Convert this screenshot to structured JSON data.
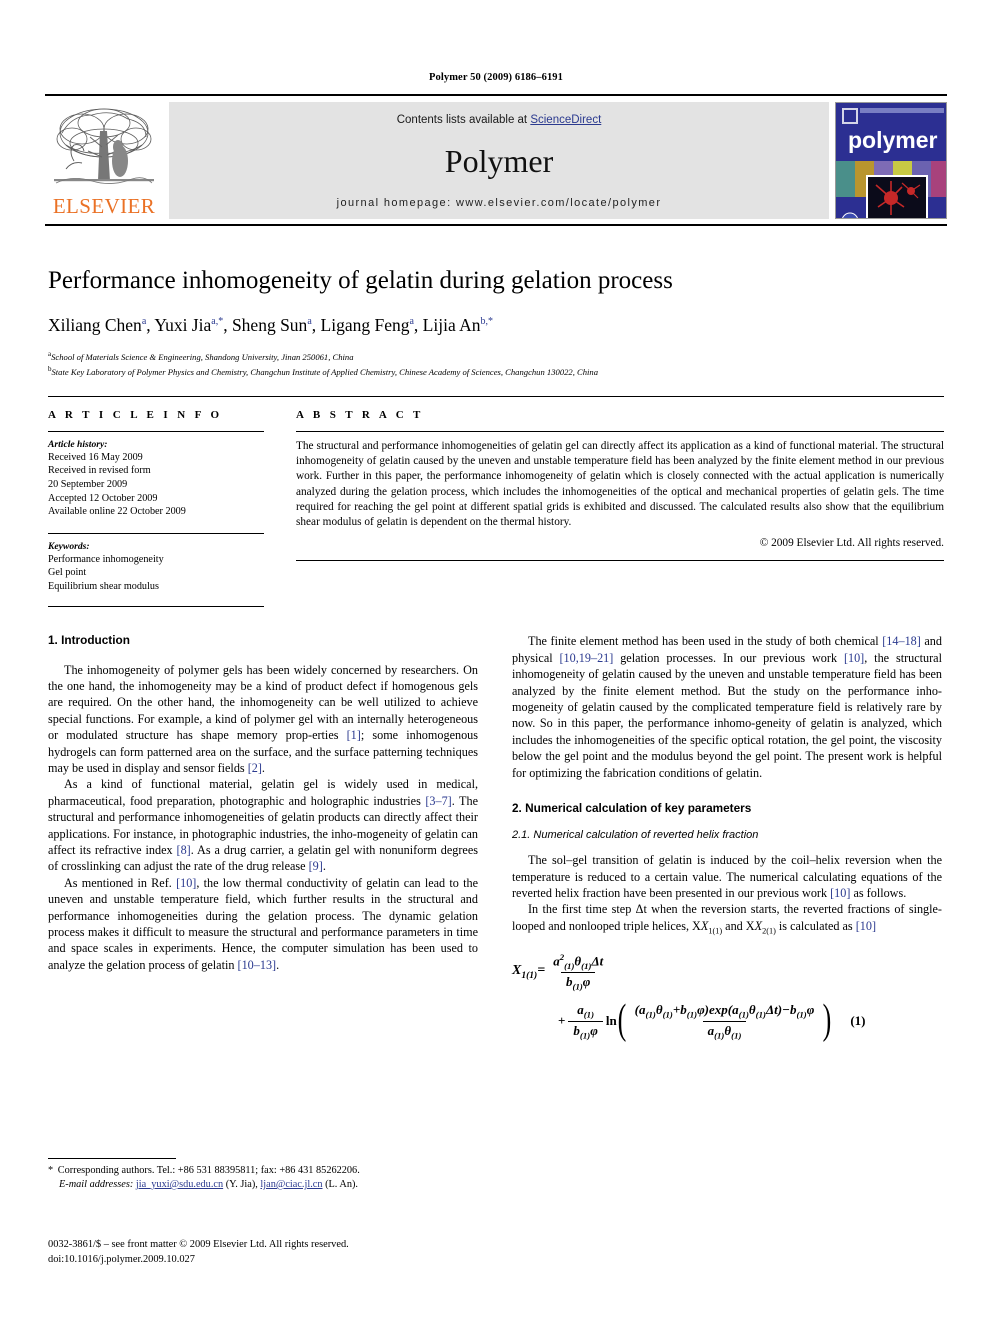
{
  "running_head": "Polymer 50 (2009) 6186–6191",
  "masthead": {
    "contents_prefix": "Contents lists available at ",
    "sciencedirect": "ScienceDirect",
    "journal_name": "Polymer",
    "homepage": "journal homepage: www.elsevier.com/locate/polymer",
    "publisher_wordmark": "ELSEVIER",
    "cover_wordmark": "polymer",
    "accent_orange": "#ea7125",
    "link_blue": "#2b3a8f",
    "cover_blue": "#2c2f92"
  },
  "article": {
    "title": "Performance inhomogeneity of gelatin during gelation process",
    "authors_html": "Xiliang Chen a, Yuxi Jia a,*, Sheng Sun a, Ligang Feng a, Lijia An b,*",
    "authors": [
      {
        "name": "Xiliang Chen",
        "marks": "a"
      },
      {
        "name": "Yuxi Jia",
        "marks": "a,*"
      },
      {
        "name": "Sheng Sun",
        "marks": "a"
      },
      {
        "name": "Ligang Feng",
        "marks": "a"
      },
      {
        "name": "Lijia An",
        "marks": "b,*"
      }
    ],
    "affiliations": [
      {
        "mark": "a",
        "text": "School of Materials Science & Engineering, Shandong University, Jinan 250061, China"
      },
      {
        "mark": "b",
        "text": "State Key Laboratory of Polymer Physics and Chemistry, Changchun Institute of Applied Chemistry, Chinese Academy of Sciences, Changchun 130022, China"
      }
    ]
  },
  "article_info": {
    "heading": "A R T I C L E   I N F O",
    "history_title": "Article history:",
    "history_lines": [
      "Received 16 May 2009",
      "Received in revised form",
      "20 September 2009",
      "Accepted 12 October 2009",
      "Available online 22 October 2009"
    ],
    "keywords_title": "Keywords:",
    "keywords": [
      "Performance inhomogeneity",
      "Gel point",
      "Equilibrium shear modulus"
    ]
  },
  "abstract": {
    "heading": "A B S T R A C T",
    "text": "The structural and performance inhomogeneities of gelatin gel can directly affect its application as a kind of functional material. The structural inhomogeneity of gelatin caused by the uneven and unstable temperature field has been analyzed by the finite element method in our previous work. Further in this paper, the performance inhomogeneity of gelatin which is closely connected with the actual application is numerically analyzed during the gelation process, which includes the inhomogeneities of the optical and mechanical properties of gelatin gels. The time required for reaching the gel point at different spatial grids is exhibited and discussed. The calculated results also show that the equilibrium shear modulus of gelatin is dependent on the thermal history.",
    "copyright": "© 2009 Elsevier Ltd. All rights reserved."
  },
  "sections": {
    "intro_heading": "1. Introduction",
    "intro_p1_a": "The inhomogeneity of polymer gels has been widely concerned by researchers. On the one hand, the inhomogeneity may be a kind of product defect if homogenous gels are required. On the other hand, the inhomogeneity can be well utilized to achieve special functions. For example, a kind of polymer gel with an internally heterogeneous or modulated structure has shape memory prop-erties ",
    "intro_p1_ref1": "[1]",
    "intro_p1_b": "; some inhomogenous hydrogels can form patterned area on the surface, and the surface patterning techniques may be used in display and sensor fields ",
    "intro_p1_ref2": "[2]",
    "intro_p1_c": ".",
    "intro_p2_a": "As a kind of functional material, gelatin gel is widely used in medical, pharmaceutical, food preparation, photographic and holographic industries ",
    "intro_p2_ref1": "[3–7]",
    "intro_p2_b": ". The structural and performance inhomogeneities of gelatin products can directly affect their applications. For instance, in photographic industries, the inho-mogeneity of gelatin can affect its refractive index ",
    "intro_p2_ref2": "[8]",
    "intro_p2_c": ". As a drug carrier, a gelatin gel with nonuniform degrees of crosslinking can adjust the rate of the drug release ",
    "intro_p2_ref3": "[9]",
    "intro_p2_d": ".",
    "intro_p3_a": "As mentioned in Ref. ",
    "intro_p3_ref1": "[10]",
    "intro_p3_b": ", the low thermal conductivity of gelatin can lead to the uneven and unstable temperature field, which further results in the structural and performance inhomogeneities during the gelation process. The dynamic gelation process makes it difficult to measure the structural and performance parameters in time and space scales in experiments. Hence, the computer simulation has been used to analyze the gelation process of gelatin ",
    "intro_p3_ref2": "[10–13]",
    "intro_p3_c": ".",
    "right_p1_a": "The finite element method has been used in the study of both chemical ",
    "right_p1_ref1": "[14–18]",
    "right_p1_b": " and physical ",
    "right_p1_ref2": "[10,19–21]",
    "right_p1_c": " gelation processes. In our previous work ",
    "right_p1_ref3": "[10]",
    "right_p1_d": ", the structural inhomogeneity of gelatin caused by the uneven and unstable temperature field has been analyzed by the finite element method. But the study on the performance inho-mogeneity of gelatin caused by the complicated temperature field is relatively rare by now. So in this paper, the performance inhomo-geneity of gelatin is analyzed, which includes the inhomogeneities of the specific optical rotation, the gel point, the viscosity below the gel point and the modulus beyond the gel point. The present work is helpful for optimizing the fabrication conditions of gelatin.",
    "numerical_heading": "2. Numerical calculation of key parameters",
    "sub_heading": "2.1. Numerical calculation of reverted helix fraction",
    "right_p2_a": "The sol–gel transition of gelatin is induced by the coil–helix reversion when the temperature is reduced to a certain value. The numerical calculating equations of the reverted helix fraction have been presented in our previous work ",
    "right_p2_ref1": "[10]",
    "right_p2_b": " as follows.",
    "right_p3_a": "In the first time step Δt when the reversion starts, the reverted fractions of single-looped and nonlooped triple helices, X",
    "right_p3_sub1": "1(1)",
    "right_p3_b": " and X",
    "right_p3_sub2": "2(1)",
    "right_p3_c": " is calculated as ",
    "right_p3_ref1": "[10]"
  },
  "equation": {
    "label": "(1)",
    "lhs": "X",
    "lhs_sub": "1(1)",
    "eq_sign": "=",
    "frac1_num": "a²₍₁₎θ₍₁₎Δt",
    "frac1_den": "b₍₁₎φ",
    "plus": "+",
    "frac2_num": "a₍₁₎",
    "frac2_den": "b₍₁₎φ",
    "ln": "ln",
    "inner_num": "(a₍₁₎θ₍₁₎+b₍₁₎φ) exp(a₍₁₎θ₍₁₎Δt) − b₍₁₎φ",
    "inner_den": "a₍₁₎θ₍₁₎"
  },
  "footnotes": {
    "corresponding_star": "*",
    "corresponding": "Corresponding authors. Tel.: +86 531 88395811; fax: +86 431 85262206.",
    "email_label": "E-mail addresses:",
    "email1": "jia_yuxi@sdu.edu.cn",
    "email1_who": "(Y. Jia),",
    "email2": "ljan@ciac.jl.cn",
    "email2_who": "(L. An).",
    "issn_line": "0032-3861/$ – see front matter © 2009 Elsevier Ltd. All rights reserved.",
    "doi_line": "doi:10.1016/j.polymer.2009.10.027"
  }
}
